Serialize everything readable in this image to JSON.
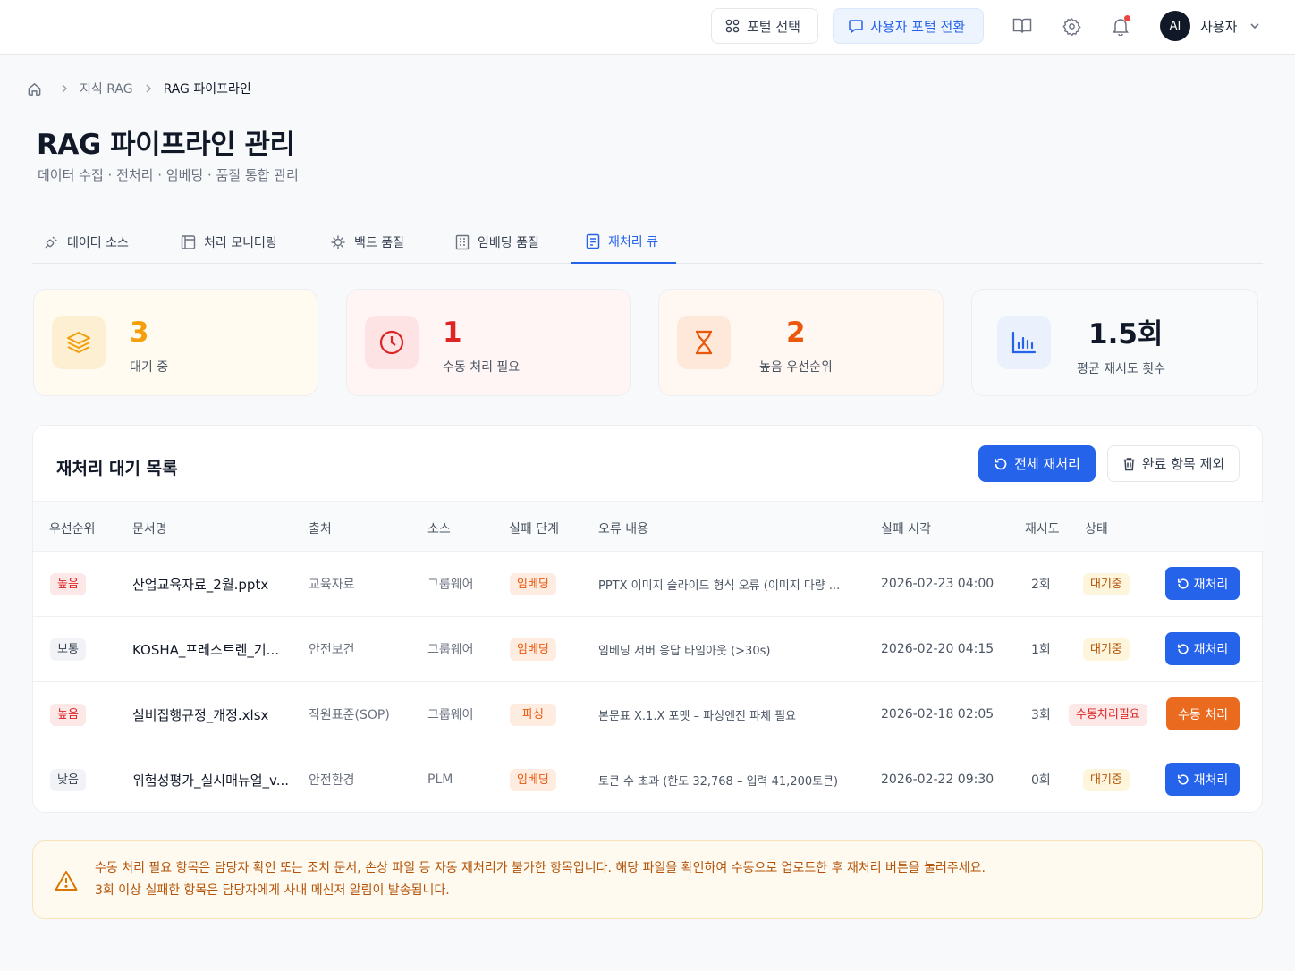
{
  "header": {
    "portal_select": "포털 선택",
    "portal_switch": "사용자 포털 전환",
    "avatar_initials": "AI",
    "username": "사용자"
  },
  "breadcrumb": {
    "parent": "지식 RAG",
    "current": "RAG 파이프라인"
  },
  "page": {
    "title": "RAG 파이프라인 관리",
    "subtitle": "데이터 수집 · 전처리 · 임베딩 · 품질 통합 관리"
  },
  "tabs": [
    {
      "label": "데이터 소스",
      "icon": "plug-icon"
    },
    {
      "label": "처리 모니터링",
      "icon": "monitor-icon"
    },
    {
      "label": "백드 품질",
      "icon": "bug-icon"
    },
    {
      "label": "임베딩 품질",
      "icon": "building-icon"
    },
    {
      "label": "재처리 큐",
      "icon": "document-icon",
      "active": true
    }
  ],
  "stats": [
    {
      "value": "3",
      "label": "대기 중",
      "icon": "layers-icon",
      "accent": "#f59e0b"
    },
    {
      "value": "1",
      "label": "수동 처리 필요",
      "icon": "clock-icon",
      "accent": "#dc2626"
    },
    {
      "value": "2",
      "label": "높음 우선순위",
      "icon": "hourglass-icon",
      "accent": "#ea580c"
    },
    {
      "value": "1.5회",
      "label": "평균 재시도 횟수",
      "icon": "bar-chart-icon",
      "accent": "#2563eb"
    }
  ],
  "queue": {
    "title": "재처리 대기 목록",
    "retry_all": "전체 재처리",
    "clear_done": "완료 항목 제외",
    "columns": [
      "우선순위",
      "문서명",
      "출처",
      "소스",
      "실패 단계",
      "오류 내용",
      "실패 시각",
      "재시도",
      "상태"
    ],
    "rows": [
      {
        "priority": "높음",
        "doc": "산업교육자료_2월.pptx",
        "origin": "교육자료",
        "source": "그룹웨어",
        "stage": "임베딩",
        "error": "PPTX 이미지 슬라이드 형식 오류 (이미지 다량 ...",
        "time": "2026-02-23 04:00",
        "retries": "2회",
        "status": "대기중",
        "action": "재처리"
      },
      {
        "priority": "보통",
        "doc": "KOSHA_프레스트렌_기...",
        "origin": "안전보건",
        "source": "그룹웨어",
        "stage": "임베딩",
        "error": "임베딩 서버 응답 타임아웃 (>30s)",
        "time": "2026-02-20 04:15",
        "retries": "1회",
        "status": "대기중",
        "action": "재처리"
      },
      {
        "priority": "높음",
        "doc": "실비집행규정_개정.xlsx",
        "origin": "직원표준(SOP)",
        "source": "그룹웨어",
        "stage": "파싱",
        "error": "본문표 X.1.X 포맷 – 파싱엔진 파체 필요",
        "time": "2026-02-18 02:05",
        "retries": "3회",
        "status": "수동처리필요",
        "action": "수동 처리"
      },
      {
        "priority": "낮음",
        "doc": "위험성평가_실시매뉴얼_v...",
        "origin": "안전환경",
        "source": "PLM",
        "stage": "임베딩",
        "error": "토큰 수 초과 (한도 32,768 – 입력 41,200토큰)",
        "time": "2026-02-22 09:30",
        "retries": "0회",
        "status": "대기중",
        "action": "재처리"
      }
    ]
  },
  "notice": {
    "line1": "수동 처리 필요 항목은 담당자 확인 또는 조치 문서, 손상 파일 등 자동 재처리가 불가한 항목입니다. 해당 파일을 확인하여 수동으로 업로드한 후 재처리 버튼을 눌러주세요.",
    "line2": "3회 이상 실패한 항목은 담당자에게 사내 메신저 알림이 발송됩니다."
  }
}
